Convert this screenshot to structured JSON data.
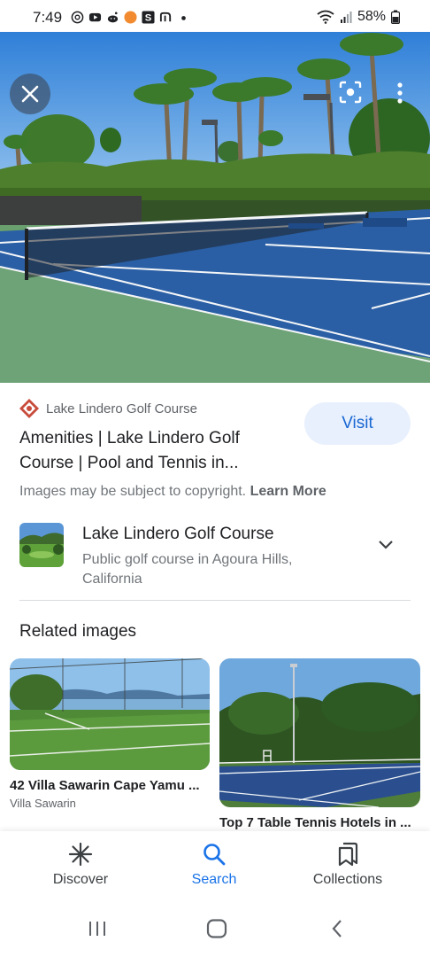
{
  "status_bar": {
    "time": "7:49",
    "battery": "58%",
    "left_icons": [
      "threads-icon",
      "youtube-icon",
      "reddit-icon",
      "orange-circle-icon",
      "s-app-icon",
      "n-app-icon",
      "dot-icon"
    ],
    "right_icons": [
      "wifi-icon",
      "signal-icon",
      "battery-icon"
    ]
  },
  "hero": {
    "close_icon": "close-icon",
    "lens_icon": "lens-icon",
    "more_icon": "more-vert-icon"
  },
  "result": {
    "source_name": "Lake Lindero Golf Course",
    "visit_label": "Visit",
    "title": "Amenities | Lake Lindero Golf Course | Pool and Tennis in...",
    "copyright_text": "Images may be subject to copyright. ",
    "learn_more": "Learn More"
  },
  "place": {
    "name": "Lake Lindero Golf Course",
    "description": "Public golf course in Agoura Hills, California"
  },
  "related": {
    "heading": "Related images",
    "items": [
      {
        "caption": "42 Villa Sawarin Cape Yamu ...",
        "source": "Villa Sawarin"
      },
      {
        "caption": "Top 7 Table Tennis Hotels in ...",
        "source": ""
      }
    ]
  },
  "bottom_nav": {
    "items": [
      {
        "label": "Discover",
        "icon": "asterisk-icon",
        "active": false
      },
      {
        "label": "Search",
        "icon": "search-icon",
        "active": true
      },
      {
        "label": "Collections",
        "icon": "bookmarks-icon",
        "active": false
      }
    ]
  },
  "colors": {
    "accent": "#1a73e8",
    "visit_bg": "#e8f0fe",
    "visit_text": "#1967d2"
  }
}
